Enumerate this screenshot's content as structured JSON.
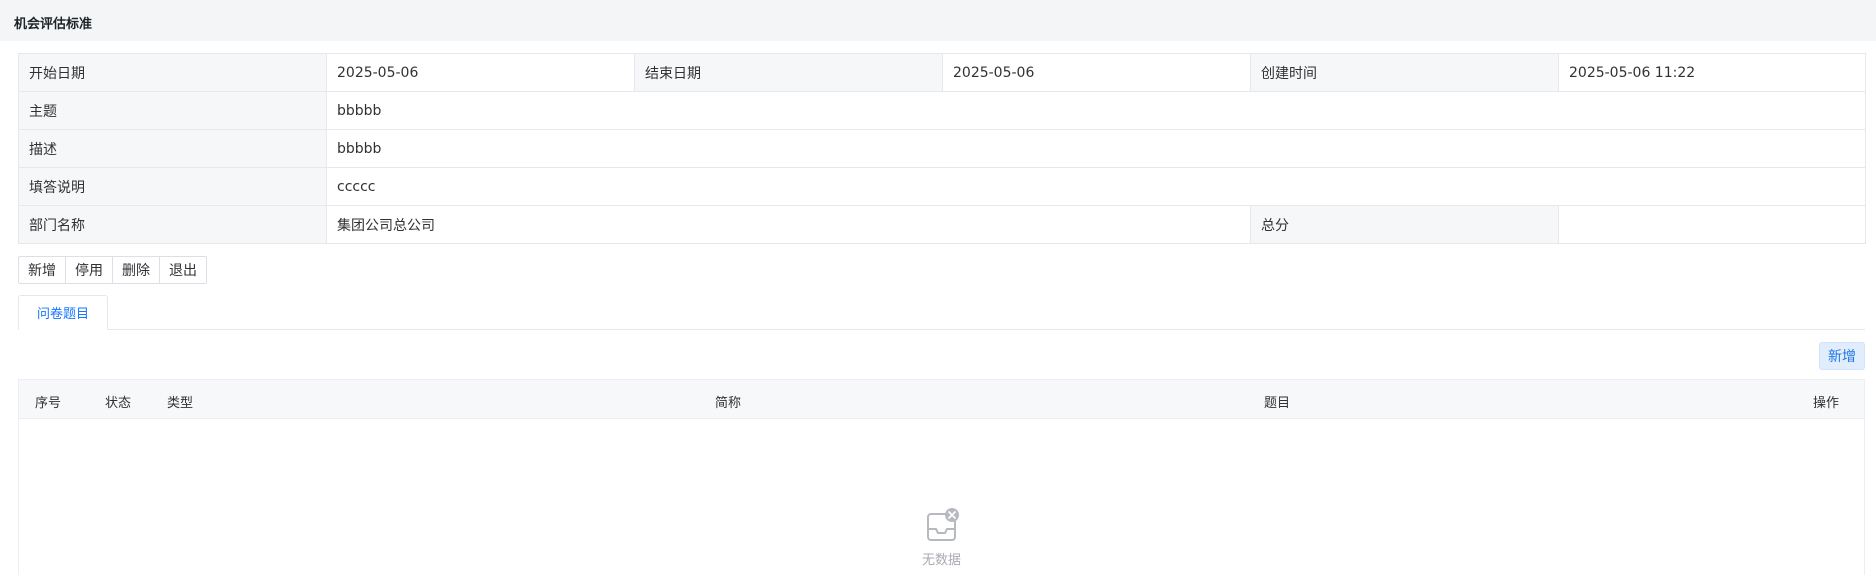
{
  "page": {
    "title": "机会评估标准"
  },
  "info": {
    "start_date_label": "开始日期",
    "start_date": "2025-05-06",
    "end_date_label": "结束日期",
    "end_date": "2025-05-06",
    "created_label": "创建时间",
    "created": "2025-05-06 11:22",
    "subject_label": "主题",
    "subject": "bbbbb",
    "description_label": "描述",
    "description": "bbbbb",
    "instructions_label": "填答说明",
    "instructions": "ccccc",
    "department_label": "部门名称",
    "department": "集团公司总公司",
    "total_label": "总分",
    "total": ""
  },
  "toolbar": {
    "add": "新增",
    "disable": "停用",
    "delete": "删除",
    "exit": "退出"
  },
  "tabs": [
    {
      "label": "问卷题目",
      "active": true
    }
  ],
  "question_table": {
    "add_label": "新增",
    "columns": [
      "序号",
      "状态",
      "类型",
      "简称",
      "题目",
      "操作"
    ],
    "rows": [],
    "empty_text": "无数据"
  },
  "colors": {
    "accent": "#1677ff",
    "header_bg": "#f4f5f7",
    "label_bg": "#f6f7f9",
    "border": "#e6e8eb"
  },
  "icons": {
    "empty": "empty-inbox-icon"
  }
}
